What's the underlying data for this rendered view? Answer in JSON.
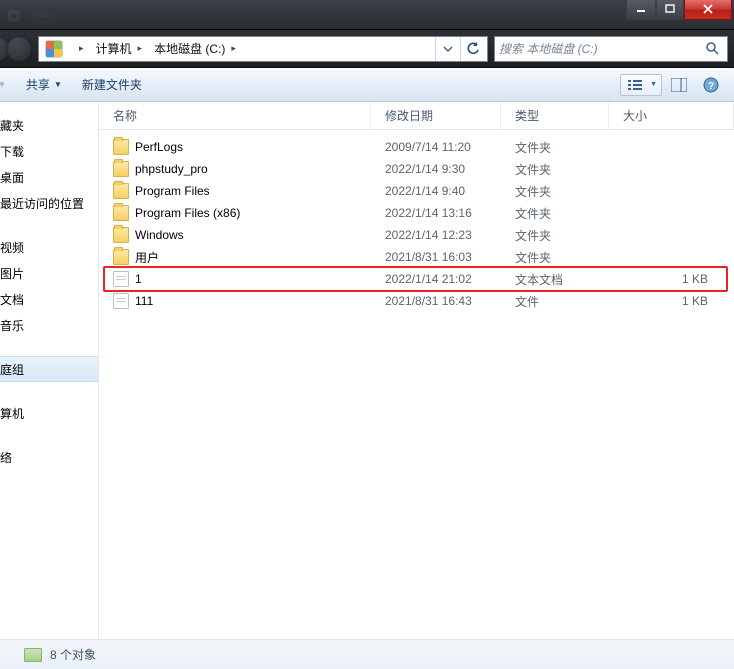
{
  "titlebar": {
    "blur_left": [
      "",
      ""
    ],
    "min_label": "Minimize",
    "max_label": "Maximize",
    "close_label": "Close"
  },
  "address": {
    "crumbs": [
      "计算机",
      "本地磁盘 (C:)"
    ],
    "refresh_label": "Refresh",
    "dropdown_label": "History"
  },
  "search": {
    "placeholder": "搜索 本地磁盘 (C:)"
  },
  "toolbar": {
    "share_label": "共享",
    "newfolder_label": "新建文件夹",
    "view_label": "Change view",
    "preview_label": "Preview pane",
    "help_label": "Help"
  },
  "columns": {
    "name": "名称",
    "date": "修改日期",
    "type": "类型",
    "size": "大小"
  },
  "nav": {
    "group1": [
      "藏夹",
      "下载",
      "桌面",
      "最近访问的位置"
    ],
    "group2": [
      "视频",
      "图片",
      "文档",
      "音乐"
    ],
    "group3": [
      "庭组"
    ],
    "group4": [
      "算机"
    ],
    "group5": [
      "络"
    ]
  },
  "files": [
    {
      "icon": "folder",
      "name": "PerfLogs",
      "date": "2009/7/14 11:20",
      "type": "文件夹",
      "size": ""
    },
    {
      "icon": "folder",
      "name": "phpstudy_pro",
      "date": "2022/1/14 9:30",
      "type": "文件夹",
      "size": ""
    },
    {
      "icon": "folder",
      "name": "Program Files",
      "date": "2022/1/14 9:40",
      "type": "文件夹",
      "size": ""
    },
    {
      "icon": "folder",
      "name": "Program Files (x86)",
      "date": "2022/1/14 13:16",
      "type": "文件夹",
      "size": ""
    },
    {
      "icon": "folder",
      "name": "Windows",
      "date": "2022/1/14 12:23",
      "type": "文件夹",
      "size": ""
    },
    {
      "icon": "folder",
      "name": "用户",
      "date": "2021/8/31 16:03",
      "type": "文件夹",
      "size": ""
    },
    {
      "icon": "file",
      "name": "1",
      "date": "2022/1/14 21:02",
      "type": "文本文档",
      "size": "1 KB"
    },
    {
      "icon": "file",
      "name": "111",
      "date": "2021/8/31 16:43",
      "type": "文件",
      "size": "1 KB"
    }
  ],
  "highlight_index": 6,
  "status": {
    "text": "8 个对象"
  }
}
